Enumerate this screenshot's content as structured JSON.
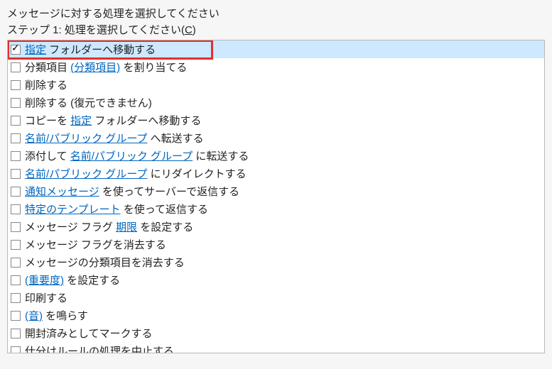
{
  "header": "メッセージに対する処理を選択してください",
  "step_prefix": "ステップ 1: 処理を選択してください(",
  "step_accel": "C",
  "step_suffix": ")",
  "rows": [
    {
      "checked": true,
      "selected": true,
      "parts": [
        {
          "t": "指定",
          "link": true
        },
        {
          "t": " フォルダーへ移動する",
          "link": false
        }
      ]
    },
    {
      "checked": false,
      "selected": false,
      "parts": [
        {
          "t": "分類項目 ",
          "link": false
        },
        {
          "t": "(分類項目)",
          "link": true
        },
        {
          "t": " を割り当てる",
          "link": false
        }
      ]
    },
    {
      "checked": false,
      "selected": false,
      "parts": [
        {
          "t": "削除する",
          "link": false
        }
      ]
    },
    {
      "checked": false,
      "selected": false,
      "parts": [
        {
          "t": "削除する (復元できません)",
          "link": false
        }
      ]
    },
    {
      "checked": false,
      "selected": false,
      "parts": [
        {
          "t": "コピーを ",
          "link": false
        },
        {
          "t": "指定",
          "link": true
        },
        {
          "t": " フォルダーへ移動する",
          "link": false
        }
      ]
    },
    {
      "checked": false,
      "selected": false,
      "parts": [
        {
          "t": "名前/パブリック グループ",
          "link": true
        },
        {
          "t": " へ転送する",
          "link": false
        }
      ]
    },
    {
      "checked": false,
      "selected": false,
      "parts": [
        {
          "t": "添付して ",
          "link": false
        },
        {
          "t": "名前/パブリック グループ",
          "link": true
        },
        {
          "t": " に転送する",
          "link": false
        }
      ]
    },
    {
      "checked": false,
      "selected": false,
      "parts": [
        {
          "t": "名前/パブリック グループ",
          "link": true
        },
        {
          "t": " にリダイレクトする",
          "link": false
        }
      ]
    },
    {
      "checked": false,
      "selected": false,
      "parts": [
        {
          "t": "通知メッセージ",
          "link": true
        },
        {
          "t": " を使ってサーバーで返信する",
          "link": false
        }
      ]
    },
    {
      "checked": false,
      "selected": false,
      "parts": [
        {
          "t": "特定のテンプレート",
          "link": true
        },
        {
          "t": " を使って返信する",
          "link": false
        }
      ]
    },
    {
      "checked": false,
      "selected": false,
      "parts": [
        {
          "t": "メッセージ フラグ ",
          "link": false
        },
        {
          "t": "期限",
          "link": true
        },
        {
          "t": " を設定する",
          "link": false
        }
      ]
    },
    {
      "checked": false,
      "selected": false,
      "parts": [
        {
          "t": "メッセージ フラグを消去する",
          "link": false
        }
      ]
    },
    {
      "checked": false,
      "selected": false,
      "parts": [
        {
          "t": "メッセージの分類項目を消去する",
          "link": false
        }
      ]
    },
    {
      "checked": false,
      "selected": false,
      "parts": [
        {
          "t": "(重要度)",
          "link": true
        },
        {
          "t": " を設定する",
          "link": false
        }
      ]
    },
    {
      "checked": false,
      "selected": false,
      "parts": [
        {
          "t": "印刷する",
          "link": false
        }
      ]
    },
    {
      "checked": false,
      "selected": false,
      "parts": [
        {
          "t": "(音)",
          "link": true
        },
        {
          "t": " を鳴らす",
          "link": false
        }
      ]
    },
    {
      "checked": false,
      "selected": false,
      "parts": [
        {
          "t": "開封済みとしてマークする",
          "link": false
        }
      ]
    },
    {
      "checked": false,
      "selected": false,
      "parts": [
        {
          "t": "仕分けルールの処理を中止する",
          "link": false
        }
      ]
    }
  ]
}
